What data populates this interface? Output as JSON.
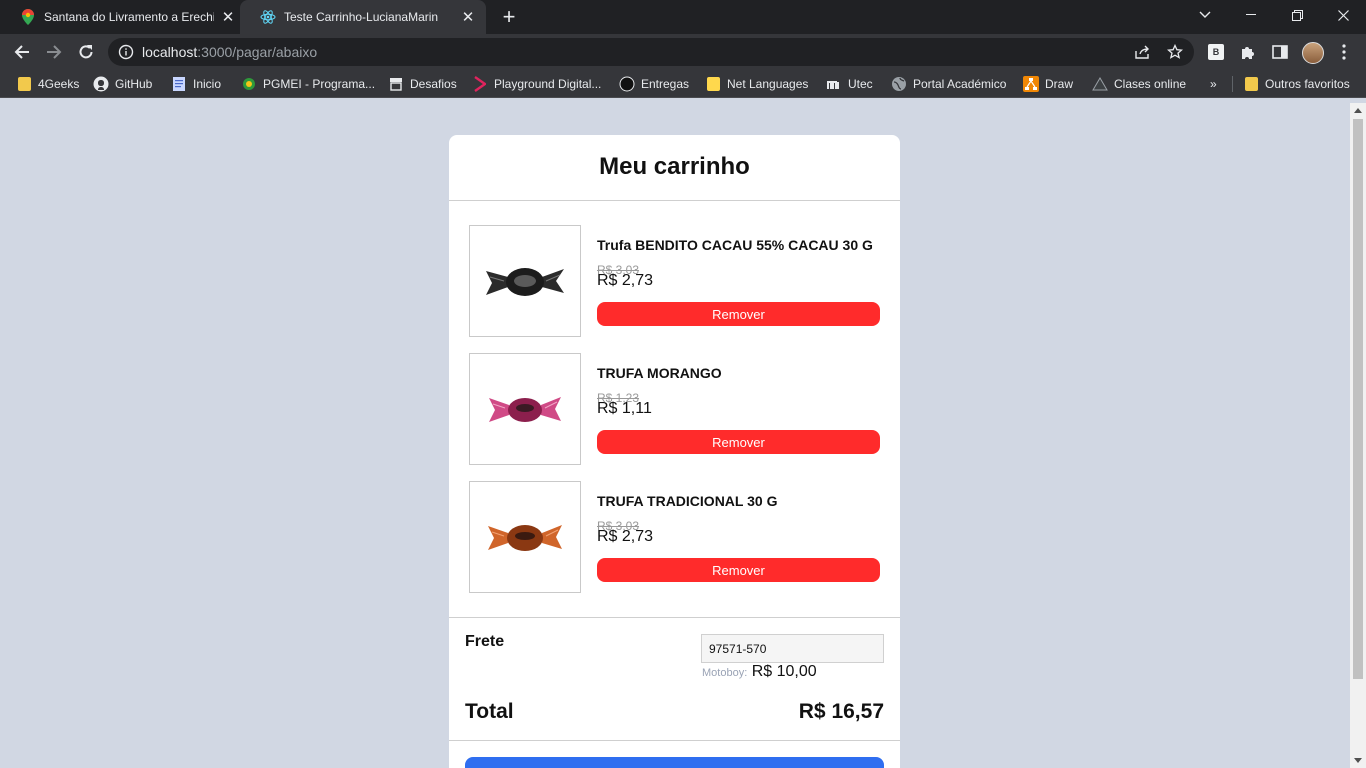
{
  "browser": {
    "tabs": [
      {
        "title": "Santana do Livramento a Erechim",
        "favicon": "maps-pin-icon"
      },
      {
        "title": "Teste Carrinho-LucianaMarin",
        "favicon": "react-icon"
      }
    ],
    "url": {
      "host": "localhost",
      "path": ":3000/pagar/abaixo"
    },
    "bookmarks": [
      {
        "label": "4Geeks",
        "icon": "folder-icon"
      },
      {
        "label": "GitHub",
        "icon": "github-icon"
      },
      {
        "label": "Inicio",
        "icon": "page-icon"
      },
      {
        "label": "PGMEI - Programa...",
        "icon": "pgmei-icon"
      },
      {
        "label": "Desafios",
        "icon": "store-icon"
      },
      {
        "label": "Playground Digital...",
        "icon": "play-icon"
      },
      {
        "label": "Entregas",
        "icon": "circle-icon"
      },
      {
        "label": "Net Languages",
        "icon": "folder-icon"
      },
      {
        "label": "Utec",
        "icon": "utec-icon"
      },
      {
        "label": "Portal Académico",
        "icon": "globe-icon"
      },
      {
        "label": "Draw",
        "icon": "draw-icon"
      },
      {
        "label": "Clases online",
        "icon": "triangle-icon"
      }
    ],
    "overflow": "»",
    "other_bookmarks": "Outros favoritos",
    "extension_badge": "B"
  },
  "cart": {
    "title": "Meu carrinho",
    "items": [
      {
        "name": "Trufa BENDITO CACAU 55% CACAU 30 G",
        "old_price": "R$ 3,03",
        "price": "R$ 2,73",
        "remove_label": "Remover",
        "wrapper_color": "#2b2b2b"
      },
      {
        "name": "TRUFA MORANGO",
        "old_price": "R$ 1,23",
        "price": "R$ 1,11",
        "remove_label": "Remover",
        "wrapper_color": "#c2326e"
      },
      {
        "name": "TRUFA TRADICIONAL 30 G",
        "old_price": "R$ 3,03",
        "price": "R$ 2,73",
        "remove_label": "Remover",
        "wrapper_color": "#c4561e"
      }
    ],
    "shipping": {
      "label": "Frete",
      "cep": "97571-570",
      "method": "Motoboy:",
      "price": "R$ 10,00"
    },
    "total": {
      "label": "Total",
      "value": "R$ 16,57"
    },
    "colors": {
      "remove": "#ff2b2b",
      "checkout": "#2f6ef0",
      "page_bg": "#d1d7e3"
    }
  }
}
